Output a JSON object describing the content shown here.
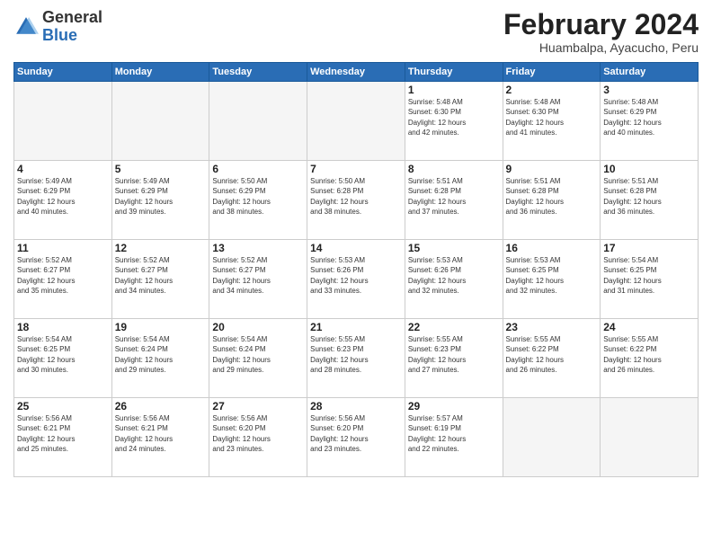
{
  "logo": {
    "general": "General",
    "blue": "Blue"
  },
  "header": {
    "title": "February 2024",
    "subtitle": "Huambalpa, Ayacucho, Peru"
  },
  "days_of_week": [
    "Sunday",
    "Monday",
    "Tuesday",
    "Wednesday",
    "Thursday",
    "Friday",
    "Saturday"
  ],
  "weeks": [
    [
      {
        "day": "",
        "info": ""
      },
      {
        "day": "",
        "info": ""
      },
      {
        "day": "",
        "info": ""
      },
      {
        "day": "",
        "info": ""
      },
      {
        "day": "1",
        "info": "Sunrise: 5:48 AM\nSunset: 6:30 PM\nDaylight: 12 hours\nand 42 minutes."
      },
      {
        "day": "2",
        "info": "Sunrise: 5:48 AM\nSunset: 6:30 PM\nDaylight: 12 hours\nand 41 minutes."
      },
      {
        "day": "3",
        "info": "Sunrise: 5:48 AM\nSunset: 6:29 PM\nDaylight: 12 hours\nand 40 minutes."
      }
    ],
    [
      {
        "day": "4",
        "info": "Sunrise: 5:49 AM\nSunset: 6:29 PM\nDaylight: 12 hours\nand 40 minutes."
      },
      {
        "day": "5",
        "info": "Sunrise: 5:49 AM\nSunset: 6:29 PM\nDaylight: 12 hours\nand 39 minutes."
      },
      {
        "day": "6",
        "info": "Sunrise: 5:50 AM\nSunset: 6:29 PM\nDaylight: 12 hours\nand 38 minutes."
      },
      {
        "day": "7",
        "info": "Sunrise: 5:50 AM\nSunset: 6:28 PM\nDaylight: 12 hours\nand 38 minutes."
      },
      {
        "day": "8",
        "info": "Sunrise: 5:51 AM\nSunset: 6:28 PM\nDaylight: 12 hours\nand 37 minutes."
      },
      {
        "day": "9",
        "info": "Sunrise: 5:51 AM\nSunset: 6:28 PM\nDaylight: 12 hours\nand 36 minutes."
      },
      {
        "day": "10",
        "info": "Sunrise: 5:51 AM\nSunset: 6:28 PM\nDaylight: 12 hours\nand 36 minutes."
      }
    ],
    [
      {
        "day": "11",
        "info": "Sunrise: 5:52 AM\nSunset: 6:27 PM\nDaylight: 12 hours\nand 35 minutes."
      },
      {
        "day": "12",
        "info": "Sunrise: 5:52 AM\nSunset: 6:27 PM\nDaylight: 12 hours\nand 34 minutes."
      },
      {
        "day": "13",
        "info": "Sunrise: 5:52 AM\nSunset: 6:27 PM\nDaylight: 12 hours\nand 34 minutes."
      },
      {
        "day": "14",
        "info": "Sunrise: 5:53 AM\nSunset: 6:26 PM\nDaylight: 12 hours\nand 33 minutes."
      },
      {
        "day": "15",
        "info": "Sunrise: 5:53 AM\nSunset: 6:26 PM\nDaylight: 12 hours\nand 32 minutes."
      },
      {
        "day": "16",
        "info": "Sunrise: 5:53 AM\nSunset: 6:25 PM\nDaylight: 12 hours\nand 32 minutes."
      },
      {
        "day": "17",
        "info": "Sunrise: 5:54 AM\nSunset: 6:25 PM\nDaylight: 12 hours\nand 31 minutes."
      }
    ],
    [
      {
        "day": "18",
        "info": "Sunrise: 5:54 AM\nSunset: 6:25 PM\nDaylight: 12 hours\nand 30 minutes."
      },
      {
        "day": "19",
        "info": "Sunrise: 5:54 AM\nSunset: 6:24 PM\nDaylight: 12 hours\nand 29 minutes."
      },
      {
        "day": "20",
        "info": "Sunrise: 5:54 AM\nSunset: 6:24 PM\nDaylight: 12 hours\nand 29 minutes."
      },
      {
        "day": "21",
        "info": "Sunrise: 5:55 AM\nSunset: 6:23 PM\nDaylight: 12 hours\nand 28 minutes."
      },
      {
        "day": "22",
        "info": "Sunrise: 5:55 AM\nSunset: 6:23 PM\nDaylight: 12 hours\nand 27 minutes."
      },
      {
        "day": "23",
        "info": "Sunrise: 5:55 AM\nSunset: 6:22 PM\nDaylight: 12 hours\nand 26 minutes."
      },
      {
        "day": "24",
        "info": "Sunrise: 5:55 AM\nSunset: 6:22 PM\nDaylight: 12 hours\nand 26 minutes."
      }
    ],
    [
      {
        "day": "25",
        "info": "Sunrise: 5:56 AM\nSunset: 6:21 PM\nDaylight: 12 hours\nand 25 minutes."
      },
      {
        "day": "26",
        "info": "Sunrise: 5:56 AM\nSunset: 6:21 PM\nDaylight: 12 hours\nand 24 minutes."
      },
      {
        "day": "27",
        "info": "Sunrise: 5:56 AM\nSunset: 6:20 PM\nDaylight: 12 hours\nand 23 minutes."
      },
      {
        "day": "28",
        "info": "Sunrise: 5:56 AM\nSunset: 6:20 PM\nDaylight: 12 hours\nand 23 minutes."
      },
      {
        "day": "29",
        "info": "Sunrise: 5:57 AM\nSunset: 6:19 PM\nDaylight: 12 hours\nand 22 minutes."
      },
      {
        "day": "",
        "info": ""
      },
      {
        "day": "",
        "info": ""
      }
    ]
  ]
}
